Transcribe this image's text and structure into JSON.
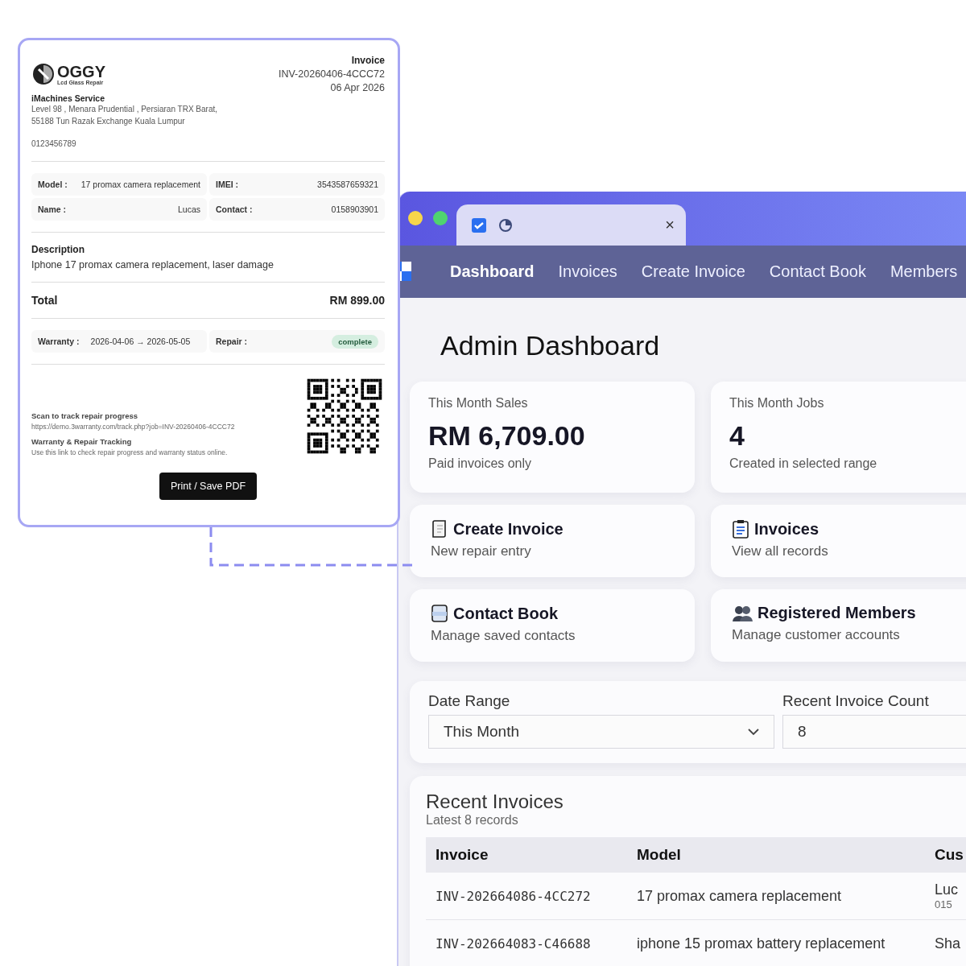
{
  "invoice": {
    "logo": {
      "name": "OGGY",
      "tagline": "Lcd Glass Repair"
    },
    "title": "Invoice",
    "number": "INV-20260406-4CCC72",
    "date": "06 Apr 2026",
    "shop": {
      "name": "iMachines Service",
      "address_lines": [
        "Level 98 , Menara Prudential , Persiaran TRX Barat,",
        "55188 Tun Razak Exchange Kuala Lumpur"
      ],
      "phone": "0123456789"
    },
    "details": [
      {
        "label": "Model :",
        "value": "17 promax camera replacement"
      },
      {
        "label": "IMEI :",
        "value": "3543587659321"
      },
      {
        "label": "Name :",
        "value": "Lucas"
      },
      {
        "label": "Contact :",
        "value": "0158903901"
      }
    ],
    "description": {
      "heading": "Description",
      "text": "Iphone 17 promax camera replacement, laser damage"
    },
    "total": {
      "label": "Total",
      "value": "RM 899.00"
    },
    "warranty": {
      "label": "Warranty :",
      "value": "2026-04-06 → 2026-05-05"
    },
    "repair": {
      "label": "Repair :",
      "status": "complete",
      "color": "#d5eee0"
    },
    "tracking": {
      "heading": "Scan to track repair progress",
      "url": "https://demo.3warranty.com/track.php?job=INV-20260406-4CCC72",
      "subheading": "Warranty & Repair Tracking",
      "note": "Use this link to check repair progress and warranty status online."
    },
    "print_button": "Print / Save PDF"
  },
  "browser": {
    "tab": {
      "close": "×"
    },
    "nav": [
      {
        "label": "Dashboard",
        "selected": true
      },
      {
        "label": "Invoices",
        "selected": false
      },
      {
        "label": "Create Invoice",
        "selected": false
      },
      {
        "label": "Contact Book",
        "selected": false
      },
      {
        "label": "Members",
        "selected": false
      }
    ],
    "title": "Admin Dashboard",
    "stats": [
      {
        "label": "This Month Sales",
        "value": "RM 6,709.00",
        "note": "Paid invoices only"
      },
      {
        "label": "This Month Jobs",
        "value": "4",
        "note": "Created in selected range"
      }
    ],
    "shortcuts": [
      {
        "kind": "scroll",
        "title": "Create Invoice",
        "subtitle": "New repair entry"
      },
      {
        "kind": "clipboard",
        "title": "Invoices",
        "subtitle": "View all records"
      },
      {
        "kind": "card",
        "title": "Contact Book",
        "subtitle": "Manage saved contacts"
      },
      {
        "kind": "people",
        "title": "Registered Members",
        "subtitle": "Manage customer accounts"
      }
    ],
    "filters": {
      "date_range": {
        "label": "Date Range",
        "value": "This Month"
      },
      "count": {
        "label": "Recent Invoice Count",
        "value": "8"
      }
    },
    "recent": {
      "title": "Recent Invoices",
      "subtitle": "Latest 8 records",
      "columns": [
        "Invoice",
        "Model",
        "Cus"
      ],
      "rows": [
        {
          "invoice": "INV-202664086-4CC272",
          "model": "17 promax camera replacement",
          "customer": "Luc",
          "phone": "015"
        },
        {
          "invoice": "INV-202664083-C46688",
          "model": "iphone 15 promax battery replacement",
          "customer": "Sha"
        }
      ]
    }
  }
}
